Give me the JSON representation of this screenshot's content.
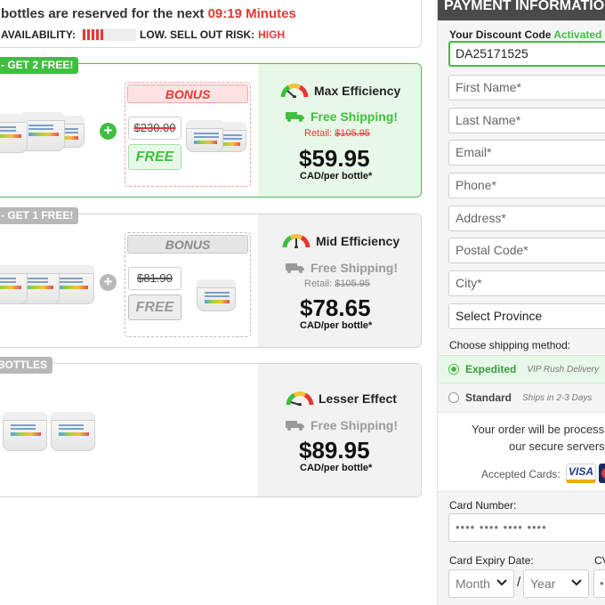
{
  "notice": {
    "line1_prefix": "bottles are reserved for the next",
    "timer": "09:19 Minutes",
    "availability_label": "AVAILABILITY:",
    "risk_label": "LOW. SELL OUT RISK:",
    "risk_value": "HIGH",
    "availability_level": 0.35
  },
  "packages": [
    {
      "tag": "- GET 2 FREE!",
      "bonus_label": "BONUS",
      "bonus_old_price": "$230.00",
      "bonus_free": "FREE",
      "efficiency": "Max Efficiency",
      "shipping": "Free Shipping!",
      "retail_label": "Retail:",
      "retail_price": "$105.95",
      "price": "$59.95",
      "per_unit": "CAD/per bottle*"
    },
    {
      "tag": "- GET 1 FREE!",
      "bonus_label": "BONUS",
      "bonus_old_price": "$81.90",
      "bonus_free": "FREE",
      "efficiency": "Mid Efficiency",
      "shipping": "Free Shipping!",
      "retail_label": "Retail:",
      "retail_price": "$105.95",
      "price": "$78.65",
      "per_unit": "CAD/per bottle*"
    },
    {
      "tag": "BOTTLES",
      "efficiency": "Lesser Effect",
      "shipping": "Free Shipping!",
      "price": "$89.95",
      "per_unit": "CAD/per bottle*"
    }
  ],
  "payment": {
    "header": "PAYMENT INFORMATIO",
    "discount_label": "Your Discount Code",
    "discount_status": "Activated",
    "discount_code": "DA25171525",
    "fields": {
      "first_name": "First Name*",
      "last_name": "Last Name*",
      "email": "Email*",
      "phone": "Phone*",
      "address": "Address*",
      "postal": "Postal Code*",
      "city": "City*"
    },
    "province": "Select Province",
    "shipping_method_label": "Choose shipping method:",
    "shipping_options": [
      {
        "name": "Expedited",
        "desc": "VIP Rush Delivery",
        "selected": true
      },
      {
        "name": "Standard",
        "desc": "Ships in 2-3 Days",
        "selected": false
      }
    ],
    "secure_line1": "Your order will be process",
    "secure_line2": "our secure servers",
    "accepted_cards": "Accepted Cards:",
    "visa": "VISA",
    "card_number_label": "Card Number:",
    "card_number_placeholder": "•••• •••• •••• ••••",
    "expiry_label": "Card Expiry Date:",
    "cvv_label": "CV",
    "month": "Month",
    "year": "Year",
    "slash": "/",
    "cvv_placeholder": "•"
  },
  "colors": {
    "accent_green": "#3fbf3f",
    "accent_red": "#e53935",
    "header_dark": "#4a4a4a"
  }
}
